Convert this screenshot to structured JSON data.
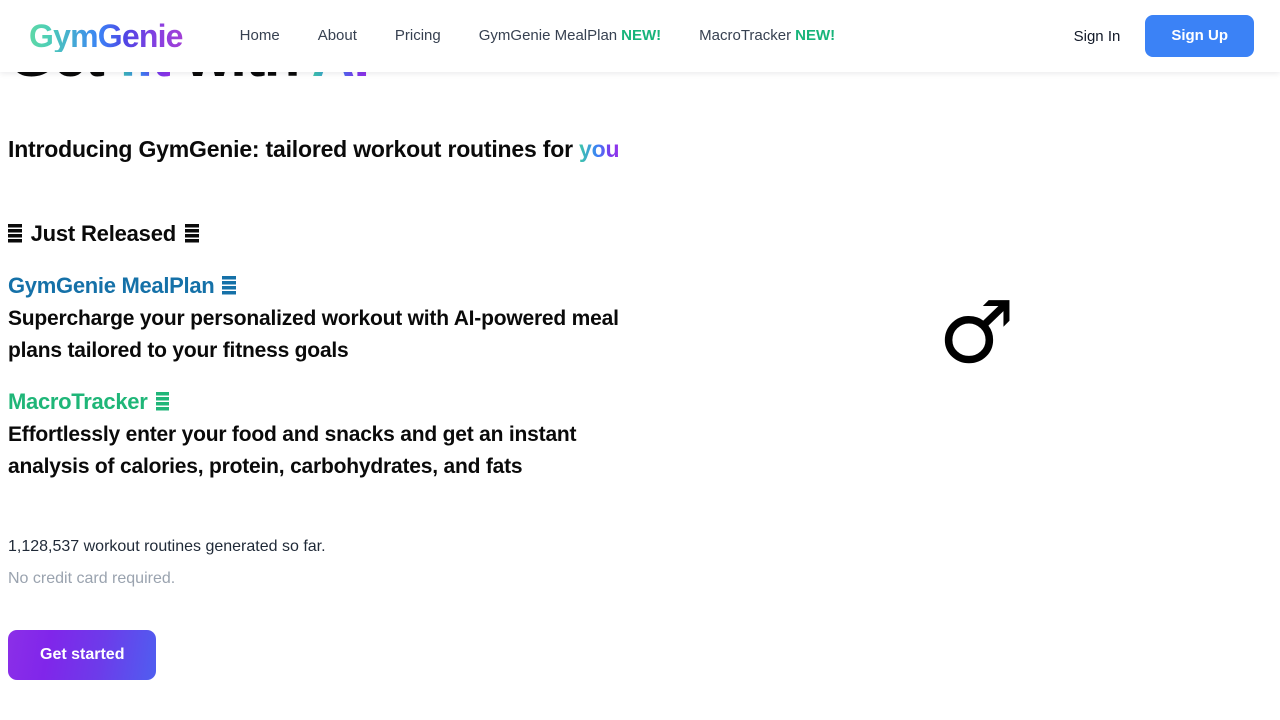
{
  "brand": {
    "name": "GymGenie",
    "gradient_start": "#5fd8a6",
    "gradient_mid": "#3b82f6",
    "gradient_end": "#a23fd6"
  },
  "header": {
    "nav": [
      {
        "label": "Home",
        "badge": ""
      },
      {
        "label": "About",
        "badge": ""
      },
      {
        "label": "Pricing",
        "badge": ""
      },
      {
        "label": "GymGenie MealPlan",
        "badge": "NEW!"
      },
      {
        "label": "MacroTracker",
        "badge": "NEW!"
      }
    ],
    "badge_color": "#17b47a",
    "sign_in_label": "Sign In",
    "sign_up_label": "Sign Up",
    "sign_up_color": "#3b82f6"
  },
  "hero": {
    "headline_part1": "Get ",
    "headline_part2": "fit",
    "headline_part3": " with ",
    "headline_part4": "AI",
    "subhead_main": "Introducing GymGenie: tailored workout routines for ",
    "subhead_accent": "you",
    "just_released": "Just Released",
    "stat_text": "1,128,537 workout routines generated so far.",
    "no_card_text": "No credit card required.",
    "cta_label": "Get started",
    "glyph": "♂"
  },
  "features": [
    {
      "title": "GymGenie MealPlan",
      "title_color": "#1571a8",
      "description": "Supercharge your personalized workout with AI-powered meal plans tailored to your fitness goals"
    },
    {
      "title": "MacroTracker",
      "title_color": "#1fb678",
      "description": "Effortlessly enter your food and snacks and get an instant analysis of calories, protein, carbohydrates, and fats"
    }
  ]
}
